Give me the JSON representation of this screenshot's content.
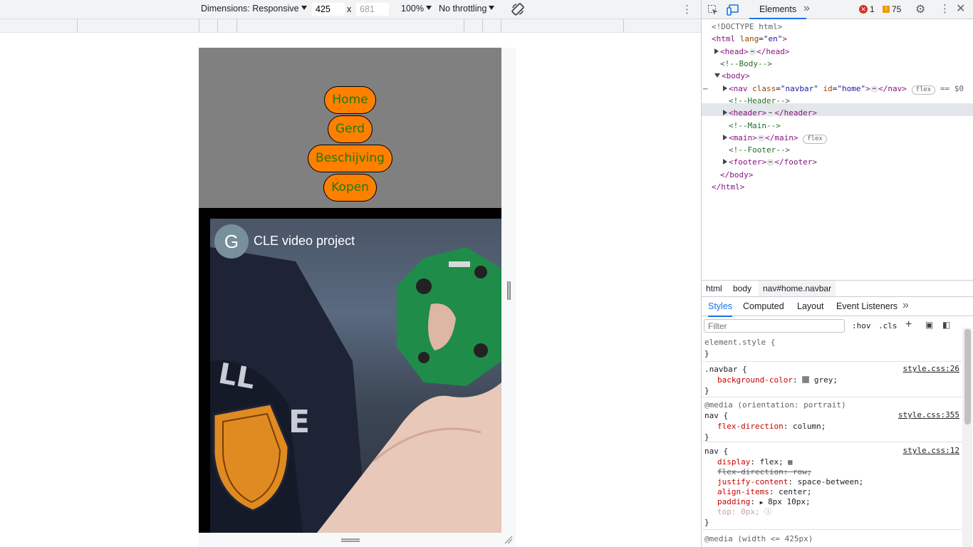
{
  "toolbar": {
    "dimensions_label": "Dimensions: Responsive",
    "width": "425",
    "x_sep": "x",
    "height": "681",
    "zoom": "100%",
    "throttling": "No throttling"
  },
  "site": {
    "nav_links": [
      "Home",
      "Gerd",
      "Beschijving",
      "Kopen"
    ],
    "video": {
      "avatar_letter": "G",
      "title": "CLE video project"
    }
  },
  "devtools": {
    "tab_elements": "Elements",
    "error_count": "1",
    "warning_count": "75",
    "dom": {
      "doctype": "<!DOCTYPE html>",
      "html_open": "<html",
      "html_lang_attr": "lang",
      "html_lang_val": "\"en\"",
      "head_open": "<head>",
      "head_close": "</head>",
      "body_comment": "<!--Body-->",
      "body_open": "<body>",
      "nav_open": "<nav",
      "nav_class_attr": "class",
      "nav_class_val": "\"navbar\"",
      "nav_id_attr": "id",
      "nav_id_val": "\"home\"",
      "nav_close": "</nav>",
      "flex_badge": "flex",
      "selected_marker": "== $0",
      "header_comment": "<!--Header-->",
      "header_open": "<header>",
      "header_close": "</header>",
      "main_comment": "<!--Main-->",
      "main_open": "<main>",
      "main_close": "</main>",
      "footer_comment": "<!--Footer-->",
      "footer_open": "<footer>",
      "footer_close": "</footer>",
      "body_close": "</body>",
      "html_close": "</html>",
      "ellipsis": "⋯"
    },
    "breadcrumbs": [
      "html",
      "body",
      "nav#home.navbar"
    ],
    "styles_tabs": [
      "Styles",
      "Computed",
      "Layout",
      "Event Listeners"
    ],
    "filter_placeholder": "Filter",
    "hov": ":hov",
    "cls": ".cls",
    "rules": {
      "element_style": "element.style {",
      "close_brace": "}",
      "navbar_selector": ".navbar {",
      "navbar_src": "style.css:26",
      "navbar_prop": "background-color",
      "navbar_val": "grey;",
      "media1": "@media (orientation: portrait)",
      "nav_selector": "nav {",
      "nav_src1": "style.css:355",
      "fd_prop": "flex-direction",
      "fd_val": "column;",
      "nav_src2": "style.css:12",
      "display_prop": "display",
      "display_val": "flex;",
      "fd_struck": "flex-direction: row;",
      "jc_prop": "justify-content",
      "jc_val": "space-between;",
      "ai_prop": "align-items",
      "ai_val": "center;",
      "pad_prop": "padding",
      "pad_val": "8px 10px;",
      "top_prop": "top",
      "top_val": "0px;",
      "media2": "@media (width <= 425px)"
    },
    "colors": {
      "accent": "#1a73e8",
      "nav_bg": "#808080",
      "button_bg": "#ff7f00",
      "button_text": "#1c7d0f"
    }
  }
}
